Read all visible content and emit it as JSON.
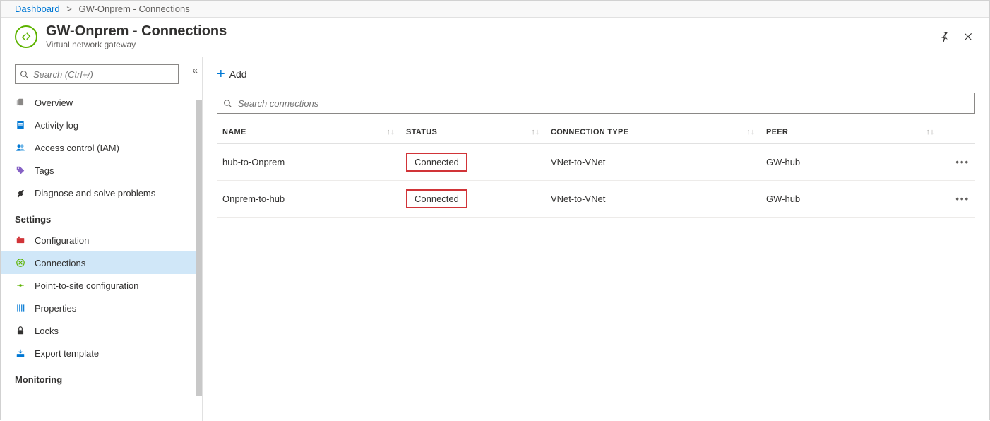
{
  "breadcrumb": {
    "root": "Dashboard",
    "current": "GW-Onprem - Connections"
  },
  "header": {
    "title": "GW-Onprem - Connections",
    "subtitle": "Virtual network gateway"
  },
  "sidebar": {
    "search_placeholder": "Search (Ctrl+/)",
    "items_top": [
      {
        "label": "Overview",
        "icon": "overview"
      },
      {
        "label": "Activity log",
        "icon": "activity"
      },
      {
        "label": "Access control (IAM)",
        "icon": "iam"
      },
      {
        "label": "Tags",
        "icon": "tags"
      },
      {
        "label": "Diagnose and solve problems",
        "icon": "diagnose"
      }
    ],
    "section_settings": "Settings",
    "items_settings": [
      {
        "label": "Configuration",
        "icon": "config"
      },
      {
        "label": "Connections",
        "icon": "connections",
        "active": true
      },
      {
        "label": "Point-to-site configuration",
        "icon": "p2s"
      },
      {
        "label": "Properties",
        "icon": "properties"
      },
      {
        "label": "Locks",
        "icon": "locks"
      },
      {
        "label": "Export template",
        "icon": "export"
      }
    ],
    "section_monitoring": "Monitoring"
  },
  "toolbar": {
    "add": "Add"
  },
  "table": {
    "search_placeholder": "Search connections",
    "columns": {
      "name": "NAME",
      "status": "STATUS",
      "type": "CONNECTION TYPE",
      "peer": "PEER"
    },
    "rows": [
      {
        "name": "hub-to-Onprem",
        "status": "Connected",
        "type": "VNet-to-VNet",
        "peer": "GW-hub"
      },
      {
        "name": "Onprem-to-hub",
        "status": "Connected",
        "type": "VNet-to-VNet",
        "peer": "GW-hub"
      }
    ]
  }
}
